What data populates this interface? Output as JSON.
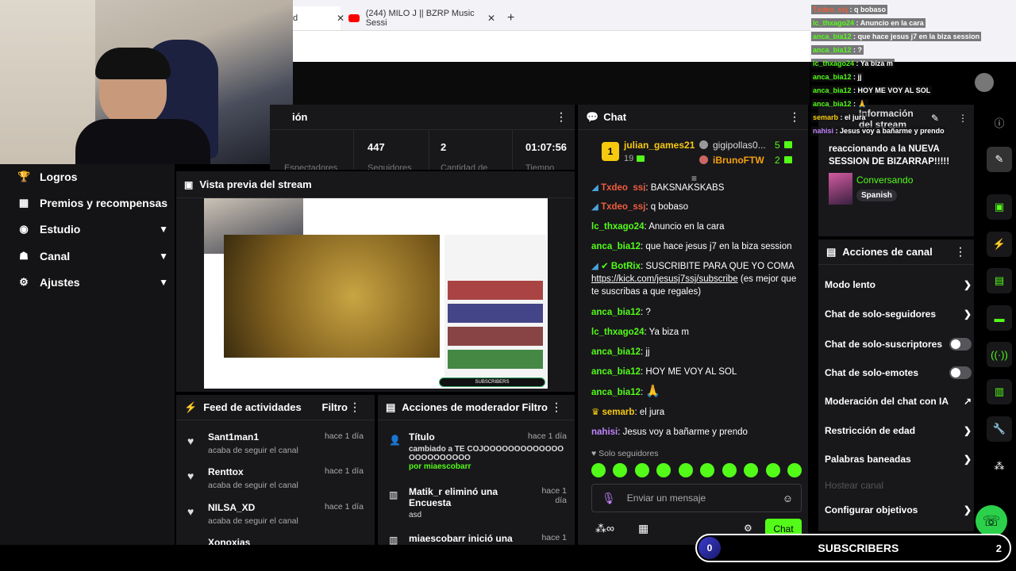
{
  "browser": {
    "tabs": [
      {
        "label": "d"
      },
      {
        "label": "(244) MILO J || BZRP Music Sessi"
      }
    ],
    "new_tab": "+"
  },
  "left_nav": {
    "items": [
      {
        "label": "Logros",
        "icon": "trophy-icon"
      },
      {
        "label": "Premios y recompensas",
        "icon": "rewards-icon"
      },
      {
        "label": "Estudio",
        "icon": "studio-icon"
      },
      {
        "label": "Canal",
        "icon": "channel-icon"
      },
      {
        "label": "Ajustes",
        "icon": "gear-icon"
      }
    ]
  },
  "stats_panel": {
    "title": "ión",
    "values": [
      "447",
      "2",
      "01:07:56"
    ],
    "labels": [
      "Espectadores",
      "Seguidores",
      "Cantidad de",
      "Tiempo"
    ]
  },
  "preview": {
    "title": "Vista previa del stream"
  },
  "feed": {
    "title": "Feed de actividades",
    "filter": "Filtro",
    "items": [
      {
        "name": "Sant1man1",
        "action": "acaba de seguir el canal",
        "time": "hace 1 día"
      },
      {
        "name": "Renttox",
        "action": "acaba de seguir el canal",
        "time": "hace 1 día"
      },
      {
        "name": "NILSA_XD",
        "action": "acaba de seguir el canal",
        "time": "hace 1 día"
      },
      {
        "name": "Xonoxias",
        "action": "",
        "time": ""
      }
    ]
  },
  "mod_actions": {
    "title": "Acciones de moderador",
    "filter": "Filtro",
    "items": [
      {
        "title": "Título",
        "detail": "cambiado a TE COJOOOOOOOOOOOOOOOOOOOOOOO",
        "by": "por miaescobarr",
        "time": "hace 1 día"
      },
      {
        "title": "Matik_r eliminó una Encuesta",
        "detail": "asd",
        "by": "",
        "time": "hace 1 día"
      },
      {
        "title": "miaescobarr inició una",
        "detail": "",
        "by": "",
        "time": "hace 1"
      }
    ]
  },
  "chat": {
    "title": "Chat",
    "top_gifters": [
      {
        "rank": "1",
        "name": "julian_games21",
        "count": "19"
      },
      {
        "name": "gigipollas0...",
        "count": "5"
      },
      {
        "name": "iBrunoFTW",
        "count": "2"
      }
    ],
    "messages": [
      {
        "user": "Txdeo_ssj",
        "text": "BAKSNAKSKABS"
      },
      {
        "user": "Txdeo_ssj",
        "text": "q bobaso"
      },
      {
        "user": "lc_thxago24",
        "text": "Anuncio en la cara"
      },
      {
        "user": "anca_bia12",
        "text": "que hace jesus j7 en la biza session"
      },
      {
        "user": "BotRix",
        "text": "SUSCRIBITE PARA QUE YO COMA"
      },
      {
        "user": "anca_bia12",
        "text": "?"
      },
      {
        "user": "lc_thxago24",
        "text": "Ya biza m"
      },
      {
        "user": "anca_bia12",
        "text": "jj"
      },
      {
        "user": "anca_bia12",
        "text": "HOY ME VOY AL SOL"
      },
      {
        "user": "anca_bia12",
        "text": "🙏"
      },
      {
        "user": "semarb",
        "text": "el jura"
      },
      {
        "user": "nahisi",
        "text": "Jesus voy a bañarme y prendo"
      }
    ],
    "botrix_link": "https://kick.com/jesusj7ssj/subscribe",
    "botrix_tail": "(es mejor que te suscribas a que regales)",
    "followers_only": "Solo seguidores",
    "input_placeholder": "Enviar un mensaje",
    "send_label": "Chat"
  },
  "stream_info": {
    "title": "Información del stream",
    "description": "reaccionando a la NUEVA SESSION DE BIZARRAP!!!!!",
    "category": "Conversando",
    "language": "Spanish"
  },
  "channel_actions": {
    "title": "Acciones de canal",
    "items": [
      {
        "label": "Modo lento",
        "control": "chevron"
      },
      {
        "label": "Chat de solo-seguidores",
        "control": "chevron"
      },
      {
        "label": "Chat de solo-suscriptores",
        "control": "toggle"
      },
      {
        "label": "Chat de solo-emotes",
        "control": "toggle"
      },
      {
        "label": "Moderación del chat con IA",
        "control": "external"
      },
      {
        "label": "Restricción de edad",
        "control": "chevron"
      },
      {
        "label": "Palabras baneadas",
        "control": "chevron"
      },
      {
        "label": "Hostear canal",
        "control": "none"
      },
      {
        "label": "Configurar objetivos",
        "control": "chevron"
      }
    ]
  },
  "overlay_chat": [
    {
      "user": "Txdeo_ssj",
      "text": "q bobaso"
    },
    {
      "user": "lc_thxago24",
      "text": "Anuncio en la cara"
    },
    {
      "user": "anca_bia12",
      "text": "que hace jesus j7 en la biza session"
    },
    {
      "user": "anca_bia12",
      "text": "?"
    },
    {
      "user": "lc_thxago24",
      "text": "Ya biza m"
    },
    {
      "user": "anca_bia12",
      "text": "jj"
    },
    {
      "user": "anca_bia12",
      "text": "HOY ME VOY AL SOL"
    },
    {
      "user": "anca_bia12",
      "text": "🙏"
    },
    {
      "user": "semarb",
      "text": "el jura"
    },
    {
      "user": "nahisi",
      "text": "Jesus voy a bañarme y prendo"
    }
  ],
  "subscribers_bar": {
    "current": "0",
    "label": "SUBSCRIBERS",
    "goal": "2"
  },
  "colors": {
    "accent": "#53fc18",
    "bg": "#0b0b0c",
    "panel": "#18181b"
  }
}
